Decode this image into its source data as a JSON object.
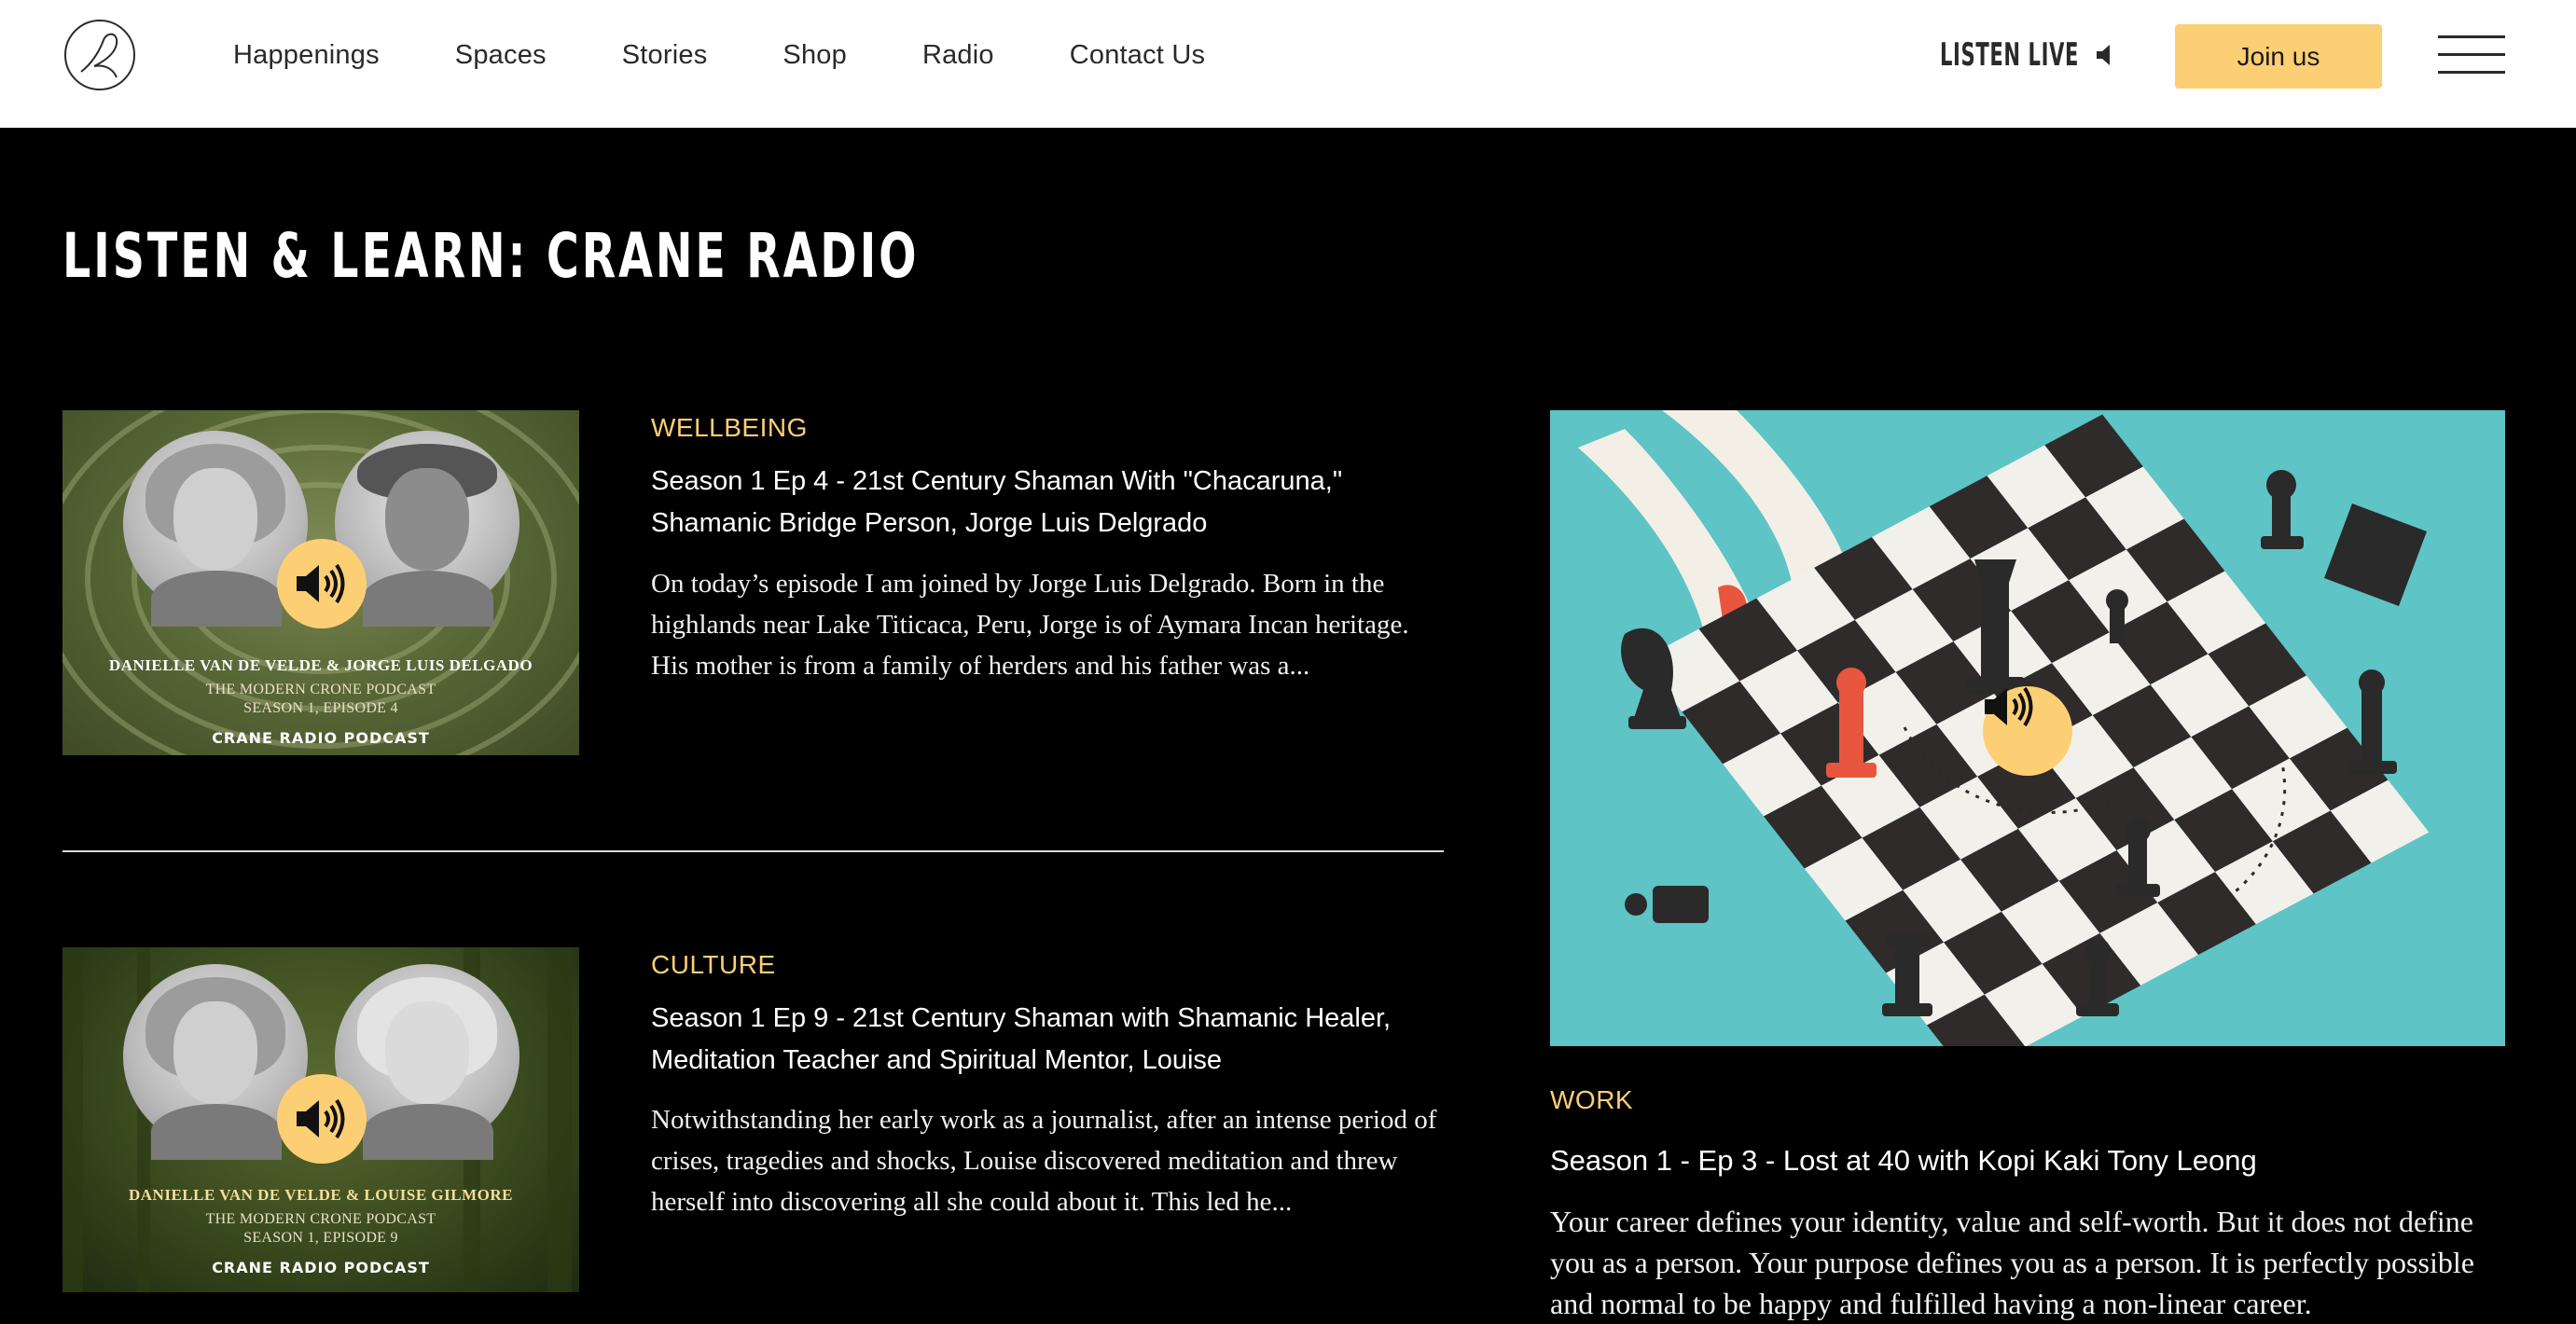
{
  "header": {
    "nav": [
      "Happenings",
      "Spaces",
      "Stories",
      "Shop",
      "Radio",
      "Contact Us"
    ],
    "listen_live": "LISTEN LIVE",
    "join_label": "Join us"
  },
  "page_title": "LISTEN & LEARN: CRANE RADIO",
  "episodes": [
    {
      "category": "WELLBEING",
      "title": "Season 1 Ep 4 - 21st Century Shaman With \"Chacaruna,\" Shamanic Bridge Person, Jorge Luis Delgrado",
      "description": "On today’s episode I am joined by Jorge Luis Delgrado. Born in the highlands near Lake Titicaca, Peru, Jorge is of Aymara Incan heritage. His mother is from a family of herders and his father was a...",
      "thumb_names": "DANIELLE VAN DE VELDE & JORGE LUIS DELGADO",
      "thumb_podcast": "THE MODERN CRONE PODCAST",
      "thumb_episode": "SEASON 1, EPISODE 4",
      "thumb_brand": "CRANE RADIO PODCAST"
    },
    {
      "category": "CULTURE",
      "title": "Season 1 Ep 9 - 21st Century Shaman with Shamanic Healer, Meditation Teacher and Spiritual Mentor, Louise",
      "description": "Notwithstanding her early work as a journalist, after an intense period of crises, tragedies and shocks, Louise discovered meditation and threw herself into discovering all she could about it. This led he...",
      "thumb_names": "DANIELLE VAN DE VELDE & LOUISE GILMORE",
      "thumb_podcast": "THE MODERN CRONE PODCAST",
      "thumb_episode": "SEASON 1, EPISODE 9",
      "thumb_brand": "CRANE RADIO PODCAST"
    }
  ],
  "featured": {
    "category": "WORK",
    "title": "Season 1 - Ep 3 - Lost at 40 with Kopi Kaki Tony Leong",
    "description": "Your career defines your identity, value and self-worth. But it does not define you as a person. Your purpose defines you as a person. It is perfectly possible and normal to be happy and fulfilled having a non-linear career."
  },
  "colors": {
    "accent": "#fdcf74",
    "background": "#000000",
    "header_bg": "#ffffff",
    "feature_bg": "#5ec4c6"
  }
}
